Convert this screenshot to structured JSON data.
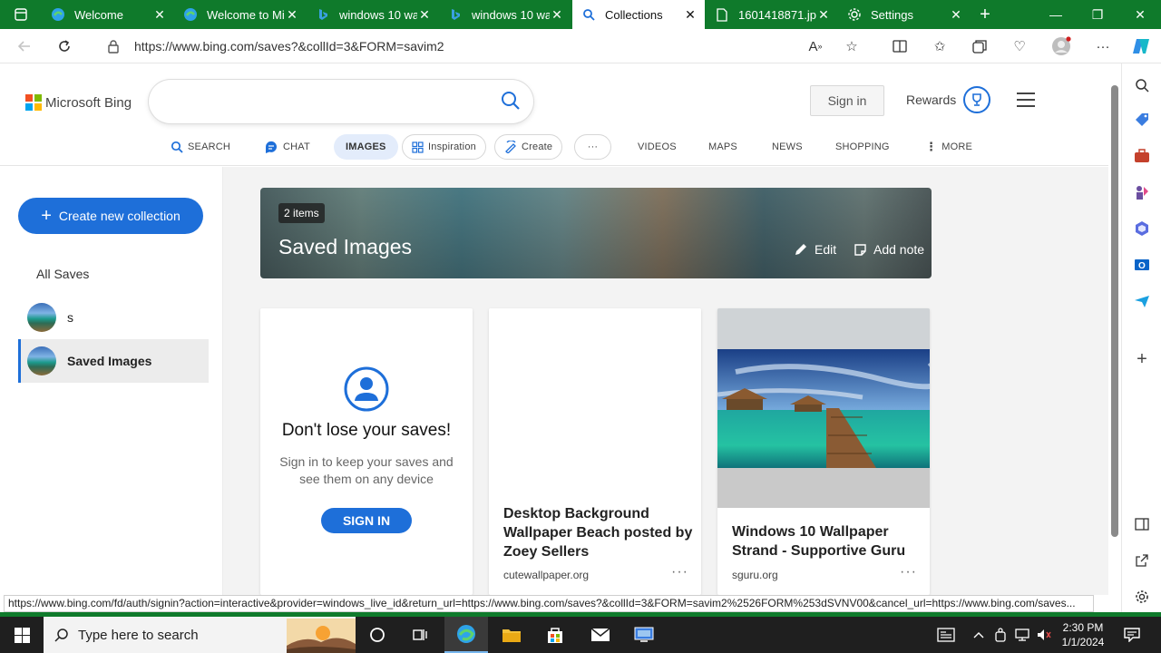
{
  "browser": {
    "tabs": [
      {
        "title": "Welcome",
        "active": false
      },
      {
        "title": "Welcome to Mi",
        "active": false
      },
      {
        "title": "windows 10 wa",
        "active": false
      },
      {
        "title": "windows 10 wa",
        "active": false
      },
      {
        "title": "Collections",
        "active": true
      },
      {
        "title": "1601418871.jp",
        "active": false
      },
      {
        "title": "Settings",
        "active": false
      }
    ],
    "url": "https://www.bing.com/saves?&collId=3&FORM=savim2",
    "colors": {
      "frame": "#0f7a2b",
      "accent": "#1e6fd9"
    }
  },
  "bing": {
    "logo_text": "Microsoft Bing",
    "signin_label": "Sign in",
    "rewards_label": "Rewards",
    "scopes": [
      {
        "label": "SEARCH",
        "icon": "search-icon"
      },
      {
        "label": "CHAT",
        "icon": "chat-icon"
      },
      {
        "label": "IMAGES",
        "icon": ""
      },
      {
        "label": "Inspiration",
        "icon": "inspiration-icon"
      },
      {
        "label": "Create",
        "icon": "create-icon"
      },
      {
        "label": "···",
        "icon": ""
      },
      {
        "label": "VIDEOS",
        "icon": ""
      },
      {
        "label": "MAPS",
        "icon": ""
      },
      {
        "label": "NEWS",
        "icon": ""
      },
      {
        "label": "SHOPPING",
        "icon": ""
      },
      {
        "label": "MORE",
        "icon": "kebab-icon"
      }
    ]
  },
  "sidebar": {
    "create_label": "Create new collection",
    "all_saves_label": "All Saves",
    "collections": [
      {
        "label": "s",
        "selected": false
      },
      {
        "label": "Saved Images",
        "selected": true
      }
    ]
  },
  "collection": {
    "count_label": "2 items",
    "title": "Saved Images",
    "edit_label": "Edit",
    "add_note_label": "Add note"
  },
  "signin_card": {
    "heading": "Don't lose your saves!",
    "body": "Sign in to keep your saves and see them on any device",
    "button": "SIGN IN"
  },
  "cards": [
    {
      "title": "Desktop Background Wallpaper Beach posted by Zoey Sellers",
      "source": "cutewallpaper.org",
      "more": "···"
    },
    {
      "title": "Windows 10 Wallpaper Strand - Supportive Guru",
      "source": "sguru.org",
      "more": "···"
    }
  ],
  "status_url": "https://www.bing.com/fd/auth/signin?action=interactive&provider=windows_live_id&return_url=https://www.bing.com/saves?&collId=3&FORM=savim2%2526FORM%253dSVNV00&cancel_url=https://www.bing.com/saves...",
  "taskbar": {
    "search_placeholder": "Type here to search",
    "time": "2:30 PM",
    "date": "1/1/2024"
  }
}
